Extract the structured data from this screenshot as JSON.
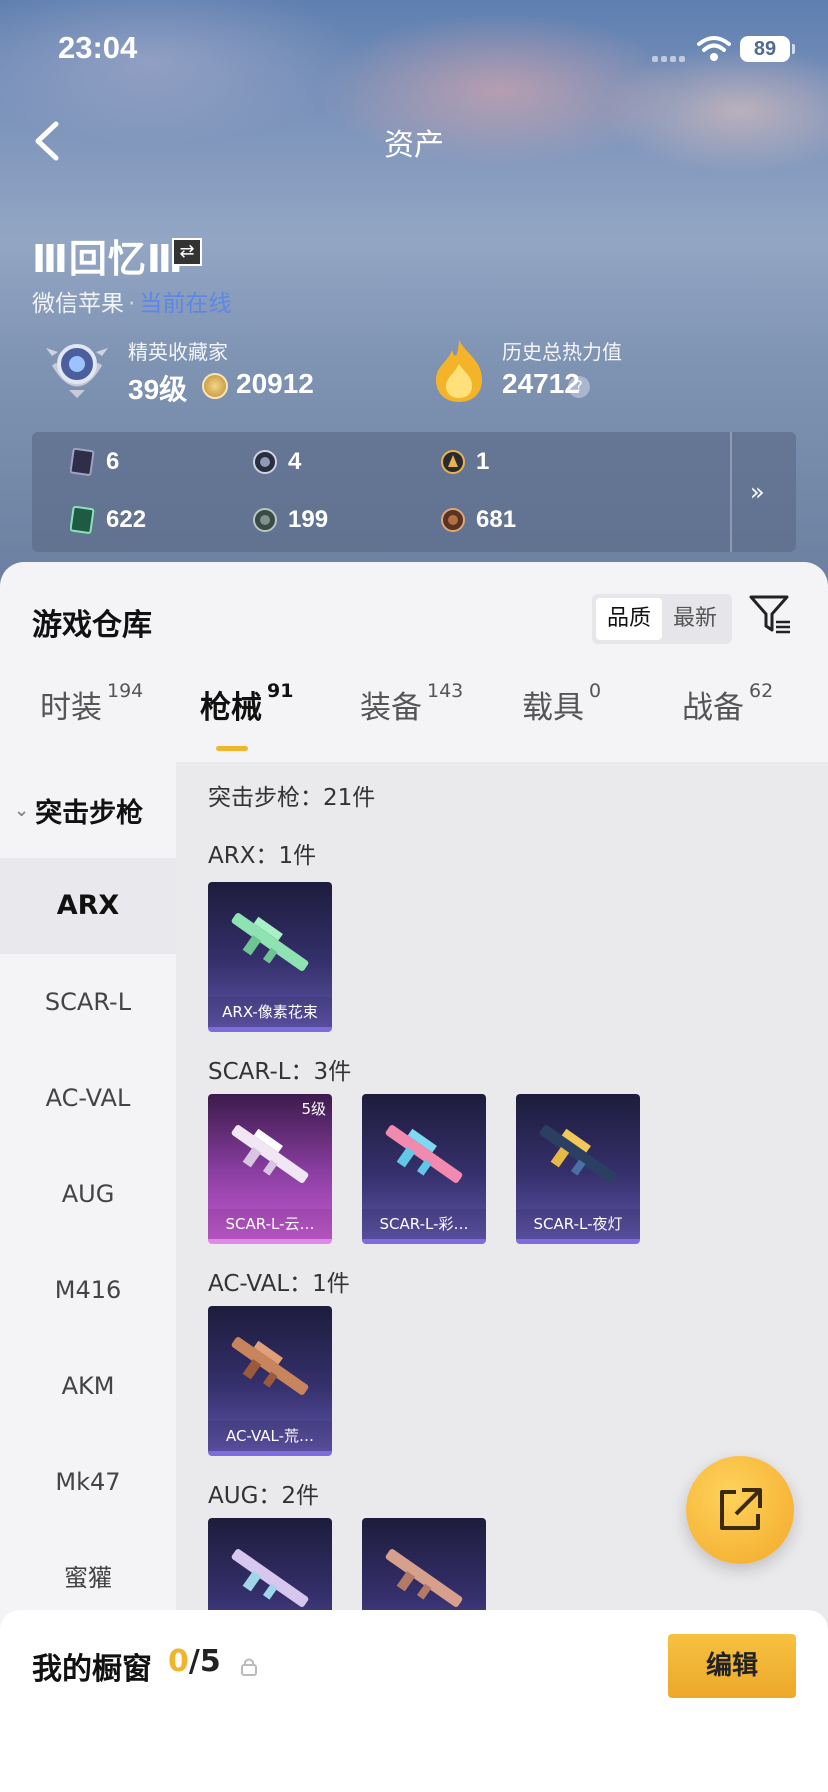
{
  "status": {
    "time": "23:04",
    "battery": "89"
  },
  "nav": {
    "title": "资产"
  },
  "profile": {
    "name": "Ⅲ回忆Ⅲ",
    "platform": "微信苹果",
    "status_link": "当前在线",
    "collector_label": "精英收藏家",
    "level": "39级",
    "points": "20912",
    "heat_label": "历史总热力值",
    "heat_value": "24712",
    "heat_help": "?"
  },
  "inventory_counts": [
    {
      "icon": "card-dark-icon",
      "value": "6"
    },
    {
      "icon": "medal-silver-icon",
      "value": "4"
    },
    {
      "icon": "medal-gold-icon",
      "value": "1"
    },
    {
      "icon": "card-green-icon",
      "value": "622"
    },
    {
      "icon": "coin-grey-icon",
      "value": "199"
    },
    {
      "icon": "coin-bronze-icon",
      "value": "681"
    }
  ],
  "inventory_more": "»",
  "warehouse": {
    "title": "游戏仓库",
    "sort_quality": "品质",
    "sort_newest": "最新"
  },
  "tabs": [
    {
      "label": "时装",
      "count": "194"
    },
    {
      "label": "枪械",
      "count": "91",
      "active": true
    },
    {
      "label": "装备",
      "count": "143"
    },
    {
      "label": "载具",
      "count": "0"
    },
    {
      "label": "战备",
      "count": "62"
    }
  ],
  "sidebar": {
    "category": "突击步枪",
    "items": [
      "ARX",
      "SCAR-L",
      "AC-VAL",
      "AUG",
      "M416",
      "AKM",
      "Mk47",
      "蜜獾"
    ]
  },
  "content": {
    "total_label": "突击步枪：21件",
    "groups": [
      {
        "label": "ARX：1件",
        "items": [
          {
            "name": "ARX-像素花束"
          }
        ]
      },
      {
        "label": "SCAR-L：3件",
        "items": [
          {
            "name": "SCAR-L-云…",
            "level": "5级"
          },
          {
            "name": "SCAR-L-彩…"
          },
          {
            "name": "SCAR-L-夜灯"
          }
        ]
      },
      {
        "label": "AC-VAL：1件",
        "items": [
          {
            "name": "AC-VAL-荒…"
          }
        ]
      },
      {
        "label": "AUG：2件",
        "items": [
          {
            "name": ""
          },
          {
            "name": ""
          }
        ]
      }
    ]
  },
  "showcase": {
    "title": "我的橱窗",
    "current": "0",
    "total": "/5",
    "edit_label": "编辑"
  },
  "colors": {
    "accent": "#f1b52b",
    "card_purple": "#35306c",
    "card_pink": "#8c3fa3"
  }
}
